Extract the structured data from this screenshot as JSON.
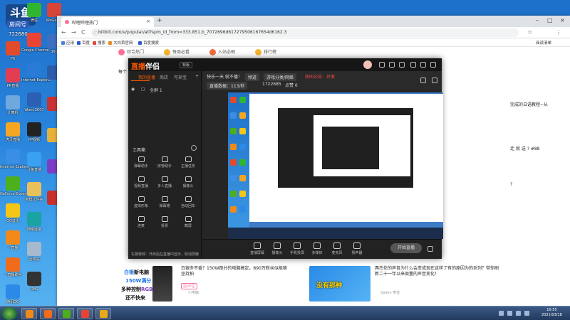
{
  "overlay": {
    "brand": "斗鱼",
    "subtitle": "房间号",
    "room_id": "722680"
  },
  "desktop": {
    "left_icons": [
      {
        "label": "P8",
        "color": "#e14b2b"
      },
      {
        "label": "PR直播",
        "color": "#e23d52"
      },
      {
        "label": "计算机",
        "color": "#6ea8dd"
      },
      {
        "label": "虎牙直播",
        "color": "#f5a623"
      },
      {
        "label": "Internet Explorer",
        "color": "#3a8ee6"
      },
      {
        "label": "GeForce Experience",
        "color": "#4caf1c"
      },
      {
        "label": "QQ音乐",
        "color": "#f5c518"
      },
      {
        "label": "一直播",
        "color": "#f28a1a"
      },
      {
        "label": "一直播助手",
        "color": "#f06b1a"
      },
      {
        "label": "腾讯QQ",
        "color": "#2b89e8"
      }
    ],
    "col2_icons": [
      {
        "label": "微信",
        "color": "#2fb52f"
      },
      {
        "label": "Google Chrome",
        "color": "#e94335"
      },
      {
        "label": "Internet Explorer",
        "color": "#2a7ad8"
      },
      {
        "label": "Word 2007",
        "color": "#2b5fb4"
      },
      {
        "label": "PP视频",
        "color": "#222222"
      },
      {
        "label": "斗鱼直播",
        "color": "#3aa0f0"
      },
      {
        "label": "新建文件夹",
        "color": "#e8c15b"
      },
      {
        "label": "网络连接",
        "color": "#1aa3a3"
      },
      {
        "label": "回收站",
        "color": "#a6b9cf"
      },
      {
        "label": "OBS",
        "color": "#333333"
      }
    ],
    "col3_icons": [
      {
        "label": "WeGame",
        "color": "#d7443a"
      },
      {
        "label": "360",
        "color": "#3f6fc2"
      },
      {
        "label": "",
        "color": "#2d5cab"
      },
      {
        "label": "",
        "color": "#c83232"
      },
      {
        "label": "",
        "color": "#e6b13a"
      },
      {
        "label": "",
        "color": "#7a3ec2"
      },
      {
        "label": "",
        "color": "#c9302c"
      }
    ]
  },
  "browser": {
    "tab_title": "哔哩哔哩热门",
    "tab_close": "×",
    "new_tab": "+",
    "controls": {
      "minimize": "–",
      "maximize": "□",
      "close": "×"
    },
    "nav": {
      "back": "←",
      "forward": "→",
      "reload": "C",
      "lock": "ⓘ"
    },
    "url": "bilibili.com/v/popular/all?spm_id_from=333.851.b_7072696d617279506167654d6162.3",
    "bookmarks": [
      {
        "label": "应用",
        "color": "#4a7fd6"
      },
      {
        "label": "百度",
        "color": "#2f58c7"
      },
      {
        "label": "搜索",
        "color": "#e0483b"
      },
      {
        "label": "大白菜官网",
        "color": "#e68a1e"
      },
      {
        "label": "百度搜索",
        "color": "#2f58c7"
      }
    ],
    "reading_list": "阅读清单",
    "bili_nav": [
      {
        "label": "综合热门",
        "color": "#fb7299"
      },
      {
        "label": "每周必看",
        "color": "#f6b32f"
      },
      {
        "label": "入站必刷",
        "color": "#f06b3a"
      },
      {
        "label": "排行榜",
        "color": "#f6b32f"
      }
    ],
    "page_texts": {
      "left_prefix": "每个",
      "right_line1": "完成的日语教程~从",
      "right_line2": "走 就 送 ? #88",
      "right_line3": "?"
    },
    "ad": {
      "line1_a": "白银",
      "line1_b": "新电脑",
      "line2": "150W满分",
      "line3_a": "多种控制",
      "line3_b": "RGB",
      "line4": "还不快来"
    },
    "videos": [
      {
        "title": "白银多不香？150W跑分的电脑搞定，890万粉丝似能够坚持拍",
        "up": "拍UP主",
        "name": "小电脑"
      },
      {
        "title": "两杰伦的声音为什么会变成现在这样了有的原因为的系列？带你刷新二十一年以来周董的声音变化！",
        "up": "",
        "name": "Salem 电音"
      }
    ],
    "thumb_text": "没有那种"
  },
  "app": {
    "brand_a": "直播",
    "brand_b": "伴侣",
    "version": "新版",
    "left_tabs": [
      "我的直播",
      "商店",
      "可来宝"
    ],
    "scene_label": "全屏 1",
    "tools_title": "工具箱",
    "tools": [
      "弹幕助手",
      "房管助手",
      "主播任务",
      "视频直播",
      "多人直播",
      "摄像头",
      "虚拟形象",
      "弹幕墙",
      "自动回车",
      "连麦",
      "投票",
      "截屏"
    ],
    "left_footer": "礼物特效：开启后在直播中显示，取消屏蔽",
    "live_title": "快乐一天 就不播！",
    "header_tags": [
      "频道",
      "游戏分类/网络",
      "房间公告：开发",
      "直播数据：113/秒",
      "1722685",
      "点赞 0"
    ],
    "bottom_buttons": [
      "直播屏幕",
      "摄像头",
      "手机投屏",
      "多媒体",
      "麦克风",
      "扬声器"
    ],
    "go_live": "开始直播"
  },
  "taskbar": {
    "apps": [
      {
        "name": "一直播",
        "color": "#f28a1a"
      },
      {
        "name": "一直播助手",
        "color": "#f06b1a"
      },
      {
        "name": "GeForce",
        "color": "#4caf1c"
      },
      {
        "name": "Chrome",
        "color": "#e94335"
      },
      {
        "name": "斗鱼直播",
        "color": "#e8a91a"
      }
    ],
    "time": "10:55",
    "date": "2021/03/18"
  }
}
